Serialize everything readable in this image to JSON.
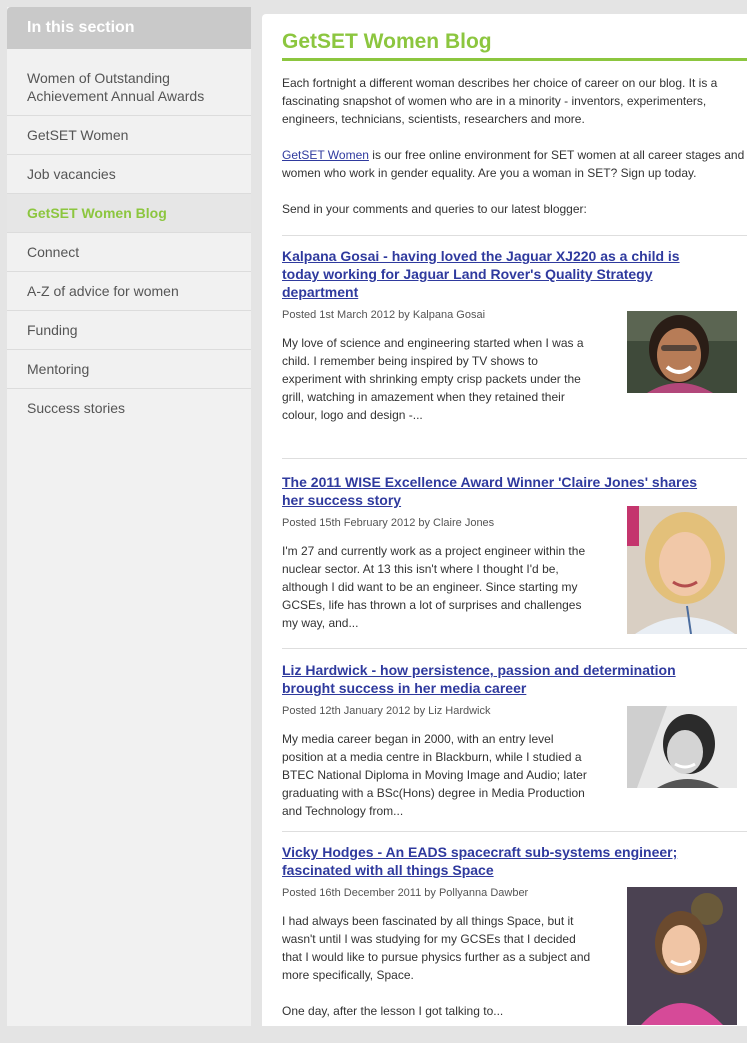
{
  "sidebar": {
    "header": "In this section",
    "items": [
      {
        "label": "Women of Outstanding Achievement Annual Awards"
      },
      {
        "label": "GetSET Women"
      },
      {
        "label": "Job vacancies"
      },
      {
        "label": "GetSET Women Blog"
      },
      {
        "label": "Connect"
      },
      {
        "label": "A-Z of advice for women"
      },
      {
        "label": "Funding"
      },
      {
        "label": "Mentoring"
      },
      {
        "label": "Success stories"
      }
    ]
  },
  "main": {
    "title": "GetSET Women Blog",
    "intro1": "Each fortnight a different woman describes her choice of career on our blog. It is a fascinating snapshot of women who are in a minority - inventors, experimenters, engineers, technicians, scientists, researchers and more.",
    "intro2_link": "GetSET Women",
    "intro2_rest": " is our free online environment for SET women at all career stages and women who work in gender equality. Are you a woman in SET? Sign up today.",
    "intro3": "Send in your comments and queries to our latest blogger:",
    "posts": [
      {
        "title": "Kalpana Gosai - having loved the Jaguar XJ220 as a child is today working for Jaguar Land Rover's Quality Strategy department",
        "meta": "Posted 1st March 2012 by Kalpana Gosai",
        "excerpt": "My love of science and engineering started when I was a child. I remember being inspired by TV shows to experiment with shrinking empty crisp packets under the grill, watching in amazement when they retained their colour, logo and design -..."
      },
      {
        "title": "The 2011 WISE Excellence Award Winner 'Claire Jones' shares her success story",
        "meta": "Posted 15th February 2012 by Claire Jones",
        "excerpt": "I'm 27 and currently work as a project engineer within the nuclear sector. At 13 this isn't where I thought I'd be, although I did want to be an engineer. Since starting my GCSEs, life has thrown a lot of surprises and challenges my way, and..."
      },
      {
        "title": "Liz Hardwick - how persistence, passion and determination brought success in her media career",
        "meta": "Posted 12th January 2012 by Liz Hardwick",
        "excerpt": "My media career began in 2000, with an entry level position at a media centre in Blackburn, while I studied a BTEC National Diploma in Moving Image and Audio; later graduating with a BSc(Hons) degree in Media Production and Technology from..."
      },
      {
        "title": "Vicky Hodges - An EADS spacecraft sub-systems engineer; fascinated with all things Space",
        "meta": "Posted 16th December 2011 by Pollyanna Dawber",
        "excerpt": "I had always been fascinated by all things Space, but it wasn't until I was studying for my GCSEs that I decided that I would like to pursue physics further as a subject and more specifically, Space.",
        "excerpt2": "One day, after the lesson I got talking to..."
      }
    ]
  },
  "colors": {
    "accent": "#8cc63f",
    "link": "#2f3a9e",
    "sidebar_header": "#c9c9c9"
  }
}
